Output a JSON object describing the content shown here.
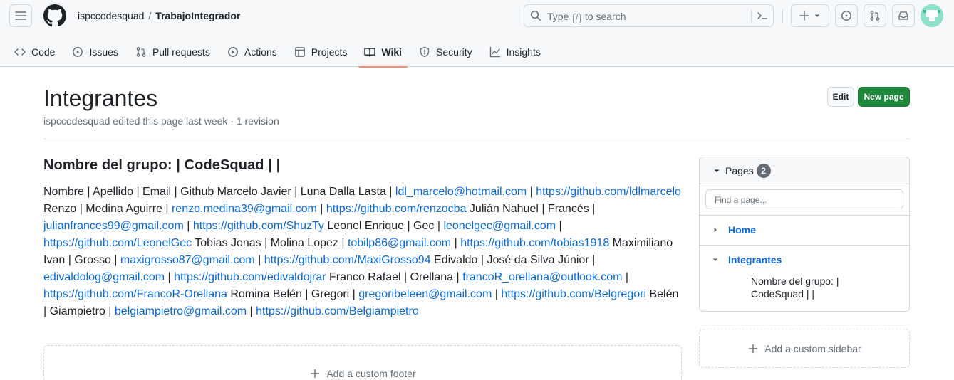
{
  "header": {
    "owner": "ispccodesquad",
    "separator": "/",
    "repo": "TrabajoIntegrador",
    "search": {
      "prefix": "Type",
      "key": "/",
      "suffix": "to search"
    },
    "icons": [
      "hamburger-icon",
      "github-logo-icon",
      "search-icon",
      "command-palette-icon",
      "plus-icon",
      "chevron-down-icon",
      "issue-icon",
      "pull-request-icon",
      "inbox-icon",
      "avatar"
    ]
  },
  "tabs": [
    {
      "label": "Code",
      "icon": "code-icon"
    },
    {
      "label": "Issues",
      "icon": "issue-icon"
    },
    {
      "label": "Pull requests",
      "icon": "pull-request-icon"
    },
    {
      "label": "Actions",
      "icon": "play-icon"
    },
    {
      "label": "Projects",
      "icon": "table-icon"
    },
    {
      "label": "Wiki",
      "icon": "book-icon",
      "active": true
    },
    {
      "label": "Security",
      "icon": "shield-icon"
    },
    {
      "label": "Insights",
      "icon": "graph-icon"
    }
  ],
  "page": {
    "title": "Integrantes",
    "meta": "ispccodesquad edited this page last week · 1 revision",
    "edit_label": "Edit",
    "new_page_label": "New page"
  },
  "content": {
    "heading": "Nombre del grupo: | CodeSquad |   |",
    "segments": [
      {
        "t": "Nombre | Apellido | Email | Github Marcelo Javier | Luna Dalla Lasta | "
      },
      {
        "link": "ldl_marcelo@hotmail.com"
      },
      {
        "t": " | "
      },
      {
        "link": "https://github.com/ldlmarcelo"
      },
      {
        "t": " Renzo | Medina Aguirre | "
      },
      {
        "link": "renzo.medina39@gmail.com"
      },
      {
        "t": " | "
      },
      {
        "link": "https://github.com/renzocba"
      },
      {
        "t": " Julián Nahuel | Francés | "
      },
      {
        "link": "julianfrances99@gmail.com"
      },
      {
        "t": " | "
      },
      {
        "link": "https://github.com/ShuzTy"
      },
      {
        "t": " Leonel Enrique | Gec | "
      },
      {
        "link": "leonelgec@gmail.com"
      },
      {
        "t": " | "
      },
      {
        "link": "https://github.com/LeonelGec"
      },
      {
        "t": " Tobias Jonas | Molina Lopez | "
      },
      {
        "link": "tobilp86@gmail.com"
      },
      {
        "t": " | "
      },
      {
        "link": "https://github.com/tobias1918"
      },
      {
        "t": " Maximiliano Ivan | Grosso | "
      },
      {
        "link": "maxigrosso87@gmail.com"
      },
      {
        "t": " | "
      },
      {
        "link": "https://github.com/MaxiGrosso94"
      },
      {
        "t": " Edivaldo | José da Silva Júnior | "
      },
      {
        "link": "edivaldolog@gmail.com"
      },
      {
        "t": " | "
      },
      {
        "link": "https://github.com/edivaldojrar"
      },
      {
        "t": " Franco Rafael | Orellana | "
      },
      {
        "link": "francoR_orellana@outlook.com"
      },
      {
        "t": " | "
      },
      {
        "link": "https://github.com/FrancoR-Orellana"
      },
      {
        "t": " Romina Belén | Gregori | "
      },
      {
        "link": "gregoribeleen@gmail.com"
      },
      {
        "t": " | "
      },
      {
        "link": "https://github.com/Belgregori"
      },
      {
        "t": " Belén | Giampietro | "
      },
      {
        "link": "belgiampietro@gmail.com"
      },
      {
        "t": " | "
      },
      {
        "link": "https://github.com/Belgiampietro"
      }
    ],
    "footer_label": "Add a custom footer"
  },
  "sidebar": {
    "pages_label": "Pages",
    "pages_count": "2",
    "find_placeholder": "Find a page...",
    "items": [
      {
        "label": "Home"
      },
      {
        "label": "Integrantes"
      }
    ],
    "sub_item": "Nombre del grupo: | CodeSquad |   |",
    "add_sidebar_label": "Add a custom sidebar"
  },
  "colors": {
    "accent": "#0969da",
    "primary_button": "#1f883d",
    "active_tab_underline": "#fd8c73"
  }
}
